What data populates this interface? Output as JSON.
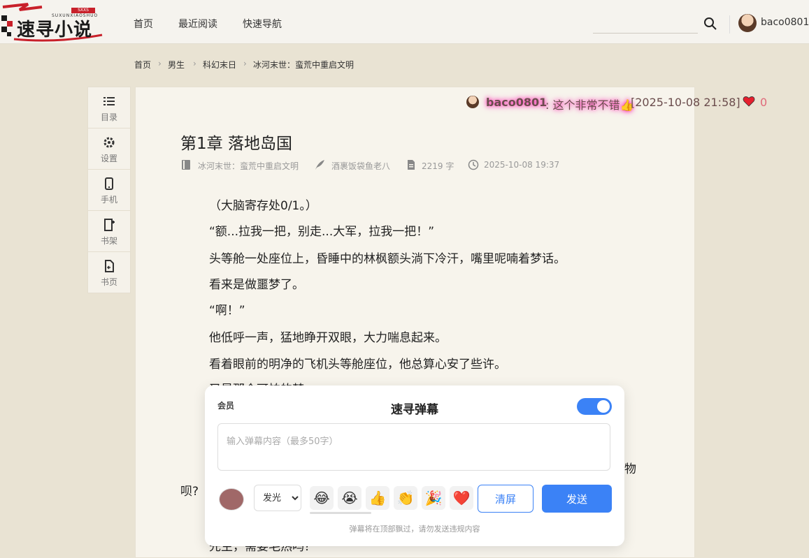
{
  "header": {
    "logo_text": "速寻小说",
    "logo_pinyin": "SUXUNXIAOSHUO",
    "logo_domain": "SXXS",
    "nav": [
      "首页",
      "最近阅读",
      "快速导航"
    ],
    "username": "baco0801"
  },
  "breadcrumb": [
    "首页",
    "男生",
    "科幻末日",
    "冰河末世：蛮荒中重启文明"
  ],
  "sidebar": {
    "items": [
      {
        "label": "目录",
        "icon": "list-icon"
      },
      {
        "label": "设置",
        "icon": "gear-icon"
      },
      {
        "label": "手机",
        "icon": "phone-icon"
      },
      {
        "label": "书架",
        "icon": "bookshelf-add-icon"
      },
      {
        "label": "书页",
        "icon": "book-page-icon"
      }
    ]
  },
  "chapter": {
    "title": "第1章 落地岛国",
    "book": "冰河末世：蛮荒中重启文明",
    "author": "酒裹饭袋鱼老八",
    "word_count": "2219 字",
    "date": "2025-10-08 19:37",
    "paragraphs": [
      "（大脑寄存处0/1。）",
      "“额...拉我一把，别走...大军，拉我一把！”",
      "头等舱一处座位上，昏睡中的林枫额头淌下冷汗，嘴里呢喃着梦话。",
      "看来是做噩梦了。",
      "“啊！”",
      "他低呼一声，猛地睁开双眼，大力喘息起来。",
      "看着眼前的明净的飞机头等舱座位，他总算心安了些许。",
      "又是那个可怕的梦"
    ],
    "partial_right": "物",
    "partial_left": "呗?",
    "partial_bottom": "先生，需要毛热吗？"
  },
  "danmaku": {
    "user": "baco0801",
    "text": ": 这个非常不错👍",
    "time": "[2025-10-08 21:58]",
    "likes": "0",
    "glow_color": "#ff2fb0"
  },
  "dialog": {
    "member_label": "会员",
    "title": "速寻弹幕",
    "toggle_on": true,
    "input_placeholder": "输入弹幕内容（最多50字）",
    "input_value": "",
    "color": "#a06868",
    "style_options": [
      "发光"
    ],
    "style_selected": "发光",
    "emojis": [
      "😂",
      "😭",
      "👍",
      "👏",
      "🎉",
      "❤️"
    ],
    "clear_label": "清屏",
    "send_label": "发送",
    "hint": "弹幕将在顶部飘过，请勿发送违规内容"
  },
  "colors": {
    "accent": "#3b82f6",
    "page_bg": "#e9e3d3",
    "panel_bg": "#f7f4ec"
  }
}
